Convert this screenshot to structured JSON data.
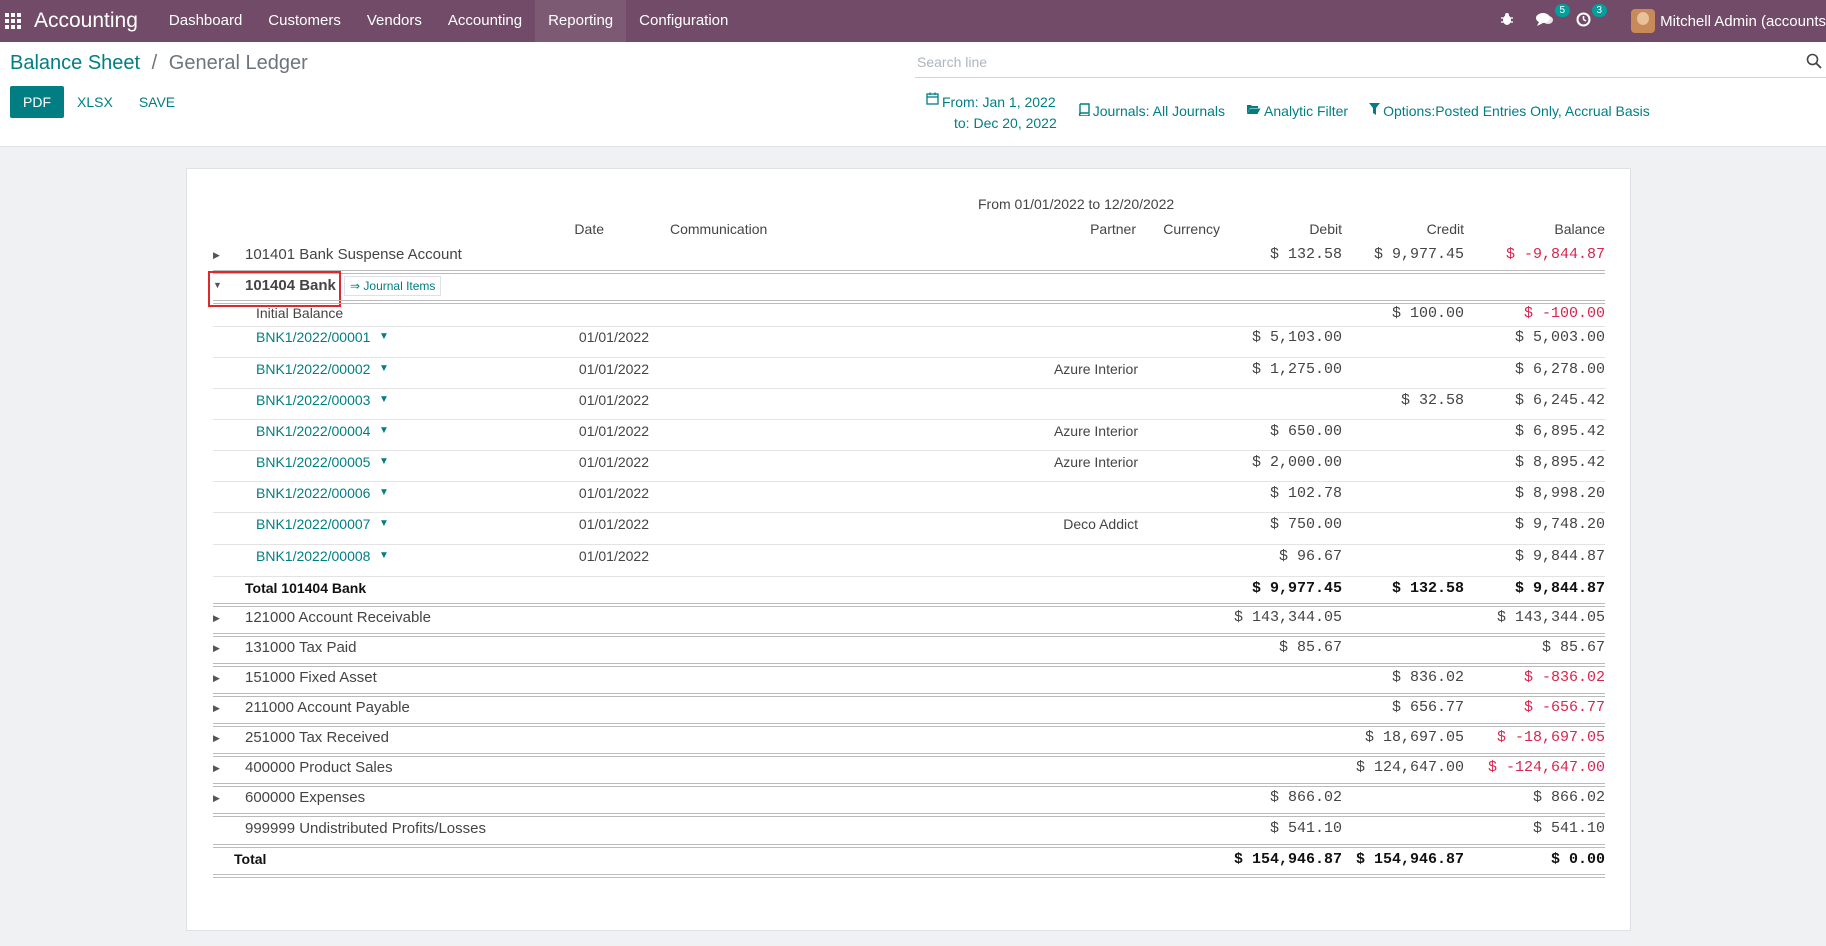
{
  "navbar": {
    "brand": "Accounting",
    "menu": [
      "Dashboard",
      "Customers",
      "Vendors",
      "Accounting",
      "Reporting",
      "Configuration"
    ],
    "active_menu": "Reporting",
    "chat_count": "5",
    "activity_count": "3",
    "user": "Mitchell Admin (accounts"
  },
  "breadcrumb": {
    "parent": "Balance Sheet",
    "separator": "/",
    "current": "General Ledger"
  },
  "buttons": {
    "pdf": "PDF",
    "xlsx": "XLSX",
    "save": "SAVE"
  },
  "search": {
    "placeholder": "Search line"
  },
  "filters": {
    "date_from": "From: Jan 1, 2022",
    "date_to": "to: Dec 20, 2022",
    "journals": "Journals: All Journals",
    "analytic": "Analytic Filter",
    "options": "Options:Posted Entries Only, Accrual Basis"
  },
  "report": {
    "period": "From 01/01/2022 to 12/20/2022",
    "columns": {
      "date": "Date",
      "communication": "Communication",
      "partner": "Partner",
      "currency": "Currency",
      "debit": "Debit",
      "credit": "Credit",
      "balance": "Balance"
    },
    "suspense": {
      "name": "101401 Bank Suspense Account",
      "debit": "$ 132.58",
      "credit": "$ 9,977.45",
      "balance": "$ -9,844.87"
    },
    "bank": {
      "name": "101404 Bank",
      "journal_items": "⇒ Journal Items",
      "initial_label": "Initial Balance",
      "initial_credit": "$ 100.00",
      "initial_balance": "$ -100.00",
      "lines": [
        {
          "ref": "BNK1/2022/00001",
          "date": "01/01/2022",
          "partner": "",
          "debit": "$ 5,103.00",
          "credit": "",
          "balance": "$ 5,003.00"
        },
        {
          "ref": "BNK1/2022/00002",
          "date": "01/01/2022",
          "partner": "Azure Interior",
          "debit": "$ 1,275.00",
          "credit": "",
          "balance": "$ 6,278.00"
        },
        {
          "ref": "BNK1/2022/00003",
          "date": "01/01/2022",
          "partner": "",
          "debit": "",
          "credit": "$ 32.58",
          "balance": "$ 6,245.42"
        },
        {
          "ref": "BNK1/2022/00004",
          "date": "01/01/2022",
          "partner": "Azure Interior",
          "debit": "$ 650.00",
          "credit": "",
          "balance": "$ 6,895.42"
        },
        {
          "ref": "BNK1/2022/00005",
          "date": "01/01/2022",
          "partner": "Azure Interior",
          "debit": "$ 2,000.00",
          "credit": "",
          "balance": "$ 8,895.42"
        },
        {
          "ref": "BNK1/2022/00006",
          "date": "01/01/2022",
          "partner": "",
          "debit": "$ 102.78",
          "credit": "",
          "balance": "$ 8,998.20"
        },
        {
          "ref": "BNK1/2022/00007",
          "date": "01/01/2022",
          "partner": "Deco Addict",
          "debit": "$ 750.00",
          "credit": "",
          "balance": "$ 9,748.20"
        },
        {
          "ref": "BNK1/2022/00008",
          "date": "01/01/2022",
          "partner": "",
          "debit": "$ 96.67",
          "credit": "",
          "balance": "$ 9,844.87"
        }
      ],
      "total_label": "Total 101404 Bank",
      "total_debit": "$ 9,977.45",
      "total_credit": "$ 132.58",
      "total_balance": "$ 9,844.87"
    },
    "accounts": [
      {
        "name": "121000 Account Receivable",
        "debit": "$ 143,344.05",
        "credit": "",
        "balance": "$ 143,344.05",
        "negative": false
      },
      {
        "name": "131000 Tax Paid",
        "debit": "$ 85.67",
        "credit": "",
        "balance": "$ 85.67",
        "negative": false
      },
      {
        "name": "151000 Fixed Asset",
        "debit": "",
        "credit": "$ 836.02",
        "balance": "$ -836.02",
        "negative": true
      },
      {
        "name": "211000 Account Payable",
        "debit": "",
        "credit": "$ 656.77",
        "balance": "$ -656.77",
        "negative": true
      },
      {
        "name": "251000 Tax Received",
        "debit": "",
        "credit": "$ 18,697.05",
        "balance": "$ -18,697.05",
        "negative": true
      },
      {
        "name": "400000 Product Sales",
        "debit": "",
        "credit": "$ 124,647.00",
        "balance": "$ -124,647.00",
        "negative": true
      },
      {
        "name": "600000 Expenses",
        "debit": "$ 866.02",
        "credit": "",
        "balance": "$ 866.02",
        "negative": false
      }
    ],
    "undistributed": {
      "name": "999999 Undistributed Profits/Losses",
      "debit": "$ 541.10",
      "credit": "",
      "balance": "$ 541.10"
    },
    "total": {
      "label": "Total",
      "debit": "$ 154,946.87",
      "credit": "$ 154,946.87",
      "balance": "$ 0.00"
    }
  }
}
